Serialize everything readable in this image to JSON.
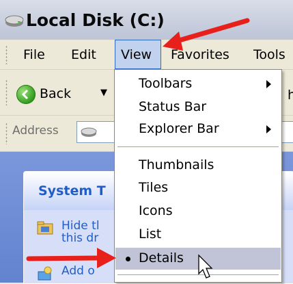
{
  "window": {
    "title": "Local Disk (C:)"
  },
  "menubar": {
    "items": [
      {
        "label": "File"
      },
      {
        "label": "Edit"
      },
      {
        "label": "View"
      },
      {
        "label": "Favorites"
      },
      {
        "label": "Tools"
      }
    ]
  },
  "toolbar": {
    "back_label": "Back",
    "back_dropdown_glyph": "▼",
    "truncated_text": "h"
  },
  "address": {
    "label": "Address"
  },
  "task_panel": {
    "title_fragment": "System T",
    "item1_line1": "Hide tl",
    "item1_line2": "this dr",
    "item2_fragment": "Add o"
  },
  "view_menu": {
    "items": [
      {
        "label": "Toolbars",
        "submenu": true
      },
      {
        "label": "Status Bar",
        "submenu": false
      },
      {
        "label": "Explorer Bar",
        "submenu": true
      },
      {
        "label": "Thumbnails",
        "submenu": false
      },
      {
        "label": "Tiles",
        "submenu": false
      },
      {
        "label": "Icons",
        "submenu": false
      },
      {
        "label": "List",
        "submenu": false
      },
      {
        "label": "Details",
        "submenu": false,
        "selected": true
      }
    ]
  },
  "colors": {
    "annotation_arrow": "#e8201c",
    "menu_highlight": "#c1d2ee",
    "selected_item": "#c1c3d6",
    "task_link": "#215dc6"
  }
}
